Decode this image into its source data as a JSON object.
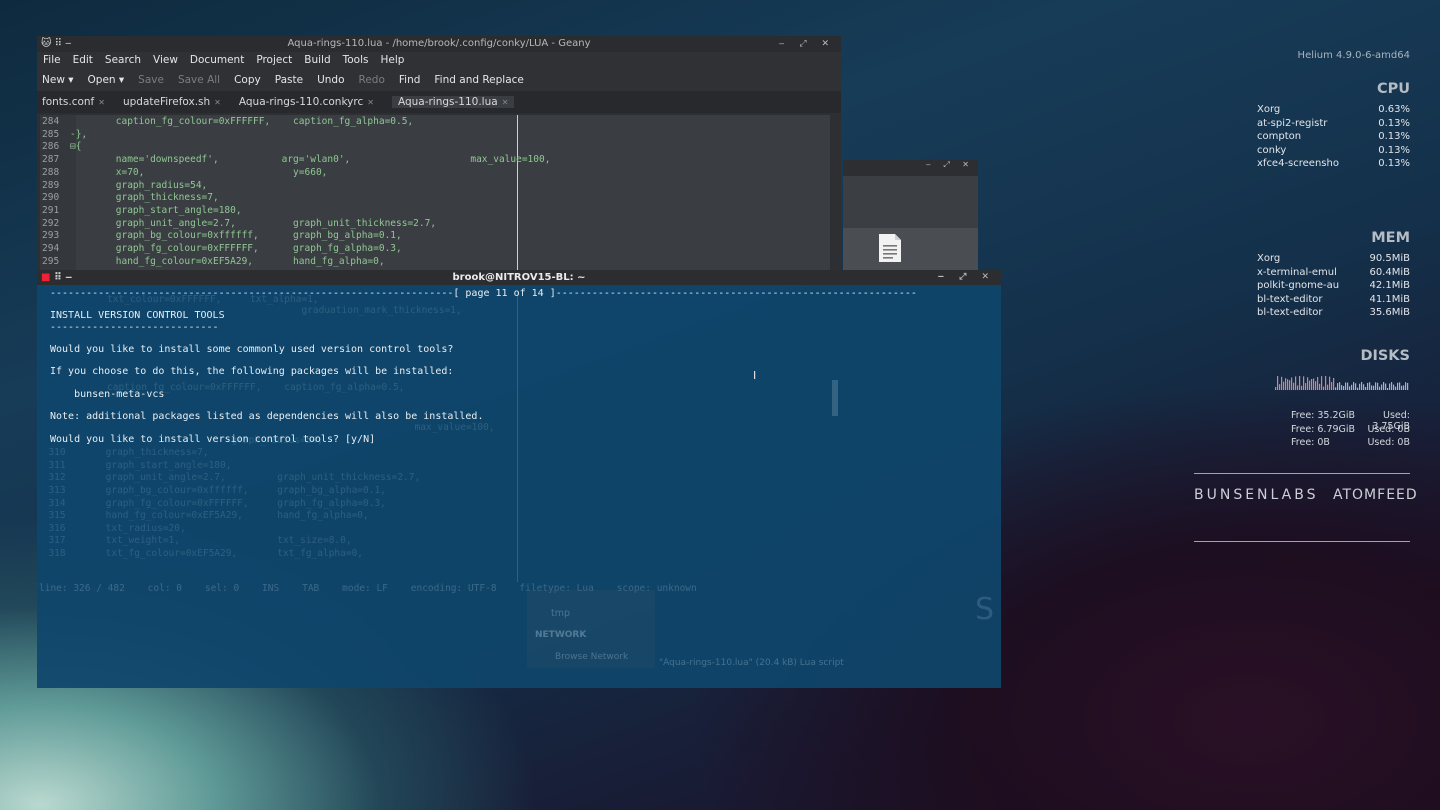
{
  "geany": {
    "title": "Aqua-rings-110.lua - /home/brook/.config/conky/LUA - Geany",
    "wm_buttons": "‒ ⤢ ✕",
    "menu": [
      "File",
      "Edit",
      "Search",
      "View",
      "Document",
      "Project",
      "Build",
      "Tools",
      "Help"
    ],
    "toolbar": [
      {
        "label": "New ▾",
        "enabled": true
      },
      {
        "label": "Open ▾",
        "enabled": true
      },
      {
        "label": "Save",
        "enabled": false
      },
      {
        "label": "Save All",
        "enabled": false
      },
      {
        "label": "Copy",
        "enabled": true
      },
      {
        "label": "Paste",
        "enabled": true
      },
      {
        "label": "Undo",
        "enabled": true
      },
      {
        "label": "Redo",
        "enabled": false
      },
      {
        "label": "Find",
        "enabled": true
      },
      {
        "label": "Find and Replace",
        "enabled": true
      }
    ],
    "tabs": [
      {
        "label": "fonts.conf",
        "close": "✕",
        "active": false
      },
      {
        "label": "updateFirefox.sh",
        "close": "✕",
        "active": false
      },
      {
        "label": "Aqua-rings-110.conkyrc",
        "close": "✕",
        "active": false
      },
      {
        "label": "Aqua-rings-110.lua",
        "close": "✕",
        "active": true
      }
    ],
    "code": [
      {
        "n": "284",
        "t": "        caption_fg_colour=0xFFFFFF,    caption_fg_alpha=0.5,"
      },
      {
        "n": "285",
        "t": "-},"
      },
      {
        "n": "286",
        "t": "⊟{"
      },
      {
        "n": "287",
        "t": "        name='downspeedf',           arg='wlan0',                     max_value=100,"
      },
      {
        "n": "288",
        "t": "        x=70,                          y=660,"
      },
      {
        "n": "289",
        "t": "        graph_radius=54,"
      },
      {
        "n": "290",
        "t": "        graph_thickness=7,"
      },
      {
        "n": "291",
        "t": "        graph_start_angle=180,"
      },
      {
        "n": "292",
        "t": "        graph_unit_angle=2.7,          graph_unit_thickness=2.7,"
      },
      {
        "n": "293",
        "t": "        graph_bg_colour=0xffffff,      graph_bg_alpha=0.1,"
      },
      {
        "n": "294",
        "t": "        graph_fg_colour=0xFFFFFF,      graph_fg_alpha=0.3,"
      },
      {
        "n": "295",
        "t": "        hand_fg_colour=0xEF5A29,       hand_fg_alpha=0,"
      }
    ]
  },
  "terminal": {
    "title": "brook@NITROV15-BL: ~",
    "wm_buttons": "‒ ⤢ ✕",
    "page_line": "-------------------------------------------------------------------[ page 11 of 14 ]------------------------------------------------------------",
    "lines": [
      "INSTALL VERSION CONTROL TOOLS",
      "----------------------------",
      "Would you like to install some commonly used version control tools?",
      "If you choose to do this, the following packages will be installed:",
      "    bunsen-meta-vcs",
      "Note: additional packages listed as dependencies will also be installed.",
      "Would you like to install version control tools? [y/N]"
    ],
    "ghost_status": "line: 326 / 482    col: 0    sel: 0    INS    TAB    mode: LF    encoding: UTF-8    filetype: Lua    scope: unknown",
    "ghost_fm": {
      "items": [
        "tmp"
      ],
      "section": "NETWORK",
      "browse": "Browse Network",
      "status": "\"Aqua-rings-110.lua\" (20.4 kB) Lua script"
    }
  },
  "conky": {
    "kernel": "Helium  4.9.0-6-amd64",
    "cpu_title": "CPU",
    "cpu": [
      {
        "name": "Xorg",
        "val": "0.63%"
      },
      {
        "name": "at-spi2-registr",
        "val": "0.13%"
      },
      {
        "name": "compton",
        "val": "0.13%"
      },
      {
        "name": "conky",
        "val": "0.13%"
      },
      {
        "name": "xfce4-screensho",
        "val": "0.13%"
      }
    ],
    "mem_title": "MEM",
    "mem": [
      {
        "name": "Xorg",
        "val": "90.5MiB"
      },
      {
        "name": "x-terminal-emul",
        "val": "60.4MiB"
      },
      {
        "name": "polkit-gnome-au",
        "val": "42.1MiB"
      },
      {
        "name": "bl-text-editor",
        "val": "41.1MiB"
      },
      {
        "name": "bl-text-editor",
        "val": "35.6MiB"
      }
    ],
    "disks_title": "DISKS",
    "disks": [
      {
        "free": "Free: 35.2GiB",
        "used": "Used: 3.75GiB"
      },
      {
        "free": "Free: 6.79GiB",
        "used": "Used: 0B"
      },
      {
        "free": "Free: 0B",
        "used": "Used: 0B"
      }
    ],
    "brand_left": "BUNSENLABS",
    "brand_right": "ATOMFEED"
  }
}
